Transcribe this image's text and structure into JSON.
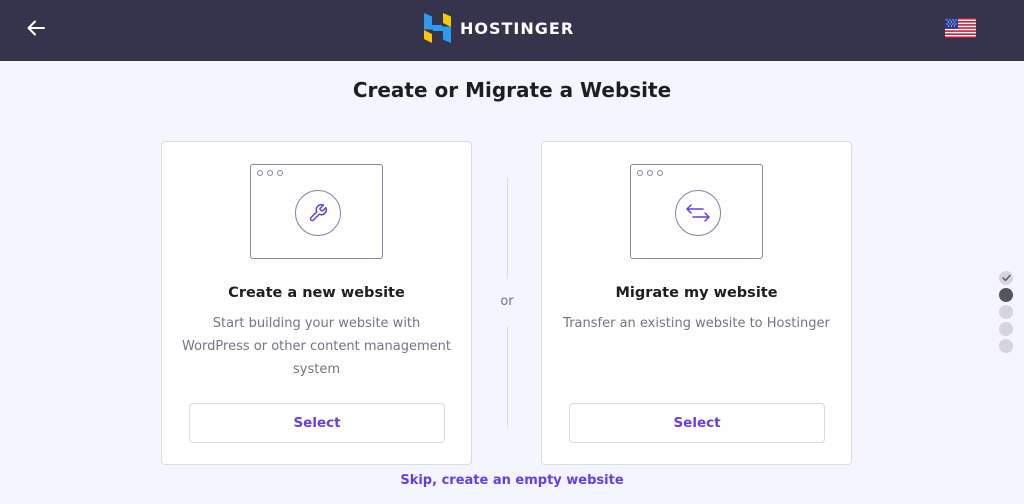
{
  "header": {
    "back_icon": "arrow-left-icon",
    "logo_text": "HOSTINGER",
    "language_flag": "us-flag-icon",
    "background": "#36344d"
  },
  "page": {
    "title": "Create or Migrate a Website"
  },
  "options": [
    {
      "icon": "wrench-icon",
      "title": "Create a new website",
      "description": "Start building your website with WordPress or other content management system",
      "button_label": "Select"
    },
    {
      "icon": "arrows-swap-icon",
      "title": "Migrate my website",
      "description": "Transfer an existing website to Hostinger",
      "button_label": "Select"
    }
  ],
  "divider_text": "or",
  "skip_link": "Skip, create an empty website",
  "progress": {
    "total_steps": 5,
    "completed_steps": 1,
    "current_step": 2
  },
  "colors": {
    "accent": "#673de6",
    "page_background": "#f4f5ff",
    "logo_blue": "#2d9cf0",
    "logo_yellow": "#f7c900"
  }
}
